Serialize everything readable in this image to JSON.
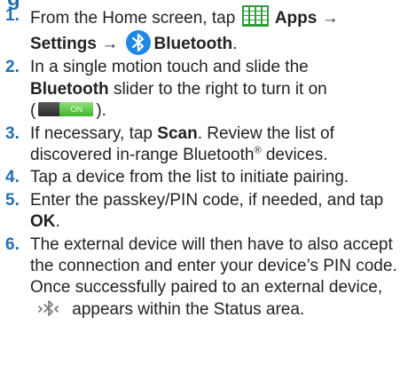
{
  "heading_fragment": "g",
  "steps": [
    {
      "num": "1.",
      "t1": "From the Home screen, tap",
      "apps": "Apps",
      "arrow1": "→",
      "settings": "Settings",
      "arrow2": "→",
      "bluetooth": "Bluetooth",
      "end": "."
    },
    {
      "num": "2.",
      "t1": "In a single motion touch and slide the",
      "bluetooth": "Bluetooth",
      "t2": "slider to the right to turn it on",
      "open": "(",
      "toggle_label": "ON",
      "close": ")."
    },
    {
      "num": "3.",
      "t1": "If necessary, tap",
      "scan": "Scan",
      "t2": ". Review the list of discovered in-range Bluetooth",
      "reg": "®",
      "t3": " devices."
    },
    {
      "num": "4.",
      "t1": "Tap a device from the list to initiate pairing."
    },
    {
      "num": "5.",
      "t1": "Enter the passkey/PIN code, if needed, and tap",
      "ok": "OK",
      "end": "."
    },
    {
      "num": "6.",
      "t1": "The external device will then have to also accept the connection and enter your device’s PIN code. Once successfully paired to an external device,",
      "t2": "appears within the Status area."
    }
  ],
  "icons": {
    "apps": "apps-grid-icon",
    "bluetooth": "bluetooth-icon",
    "toggle": "toggle-switch-icon",
    "status": "bluetooth-status-icon"
  },
  "colors": {
    "accent": "#1f6fb3",
    "apps_green": "#2e9e38",
    "bluetooth_blue": "#1e88e5",
    "toggle_green": "#4fbf3a",
    "text": "#222222"
  }
}
